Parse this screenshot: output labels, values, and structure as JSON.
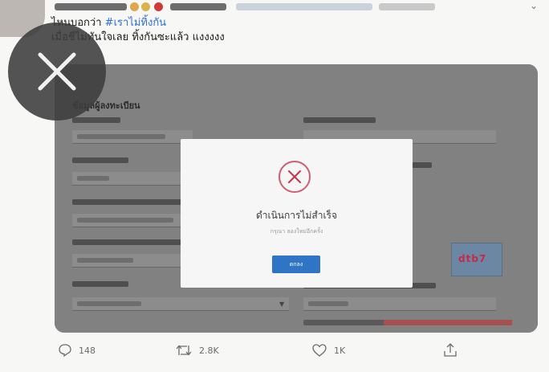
{
  "tweet": {
    "text_line1_prefix": "ไหนบอกว่า",
    "hashtag": "#เราไม่ทิ้งกัน",
    "text_line2": "เมื่อชีไม่ทันใจเลย ทิ้งกันซะแล้ว แงงงงง"
  },
  "media": {
    "form_title": "ข้อมูลผู้ลงทะเบียน",
    "captcha_text": "dtb7"
  },
  "dialog": {
    "title": "ดำเนินการไม่สำเร็จ",
    "subtitle": "กรุณา ลองใหม่อีกครั้ง",
    "ok_label": "ตกลง"
  },
  "actions": {
    "replies": "148",
    "retweets": "2.8K",
    "likes": "1K"
  },
  "colors": {
    "link": "#2a6fdb",
    "dialog_button": "#2f74c5",
    "error_icon": "#c8354f"
  },
  "icons": {
    "close": "close-icon",
    "reply": "reply-icon",
    "retweet": "retweet-icon",
    "like": "heart-icon",
    "share": "share-icon"
  }
}
